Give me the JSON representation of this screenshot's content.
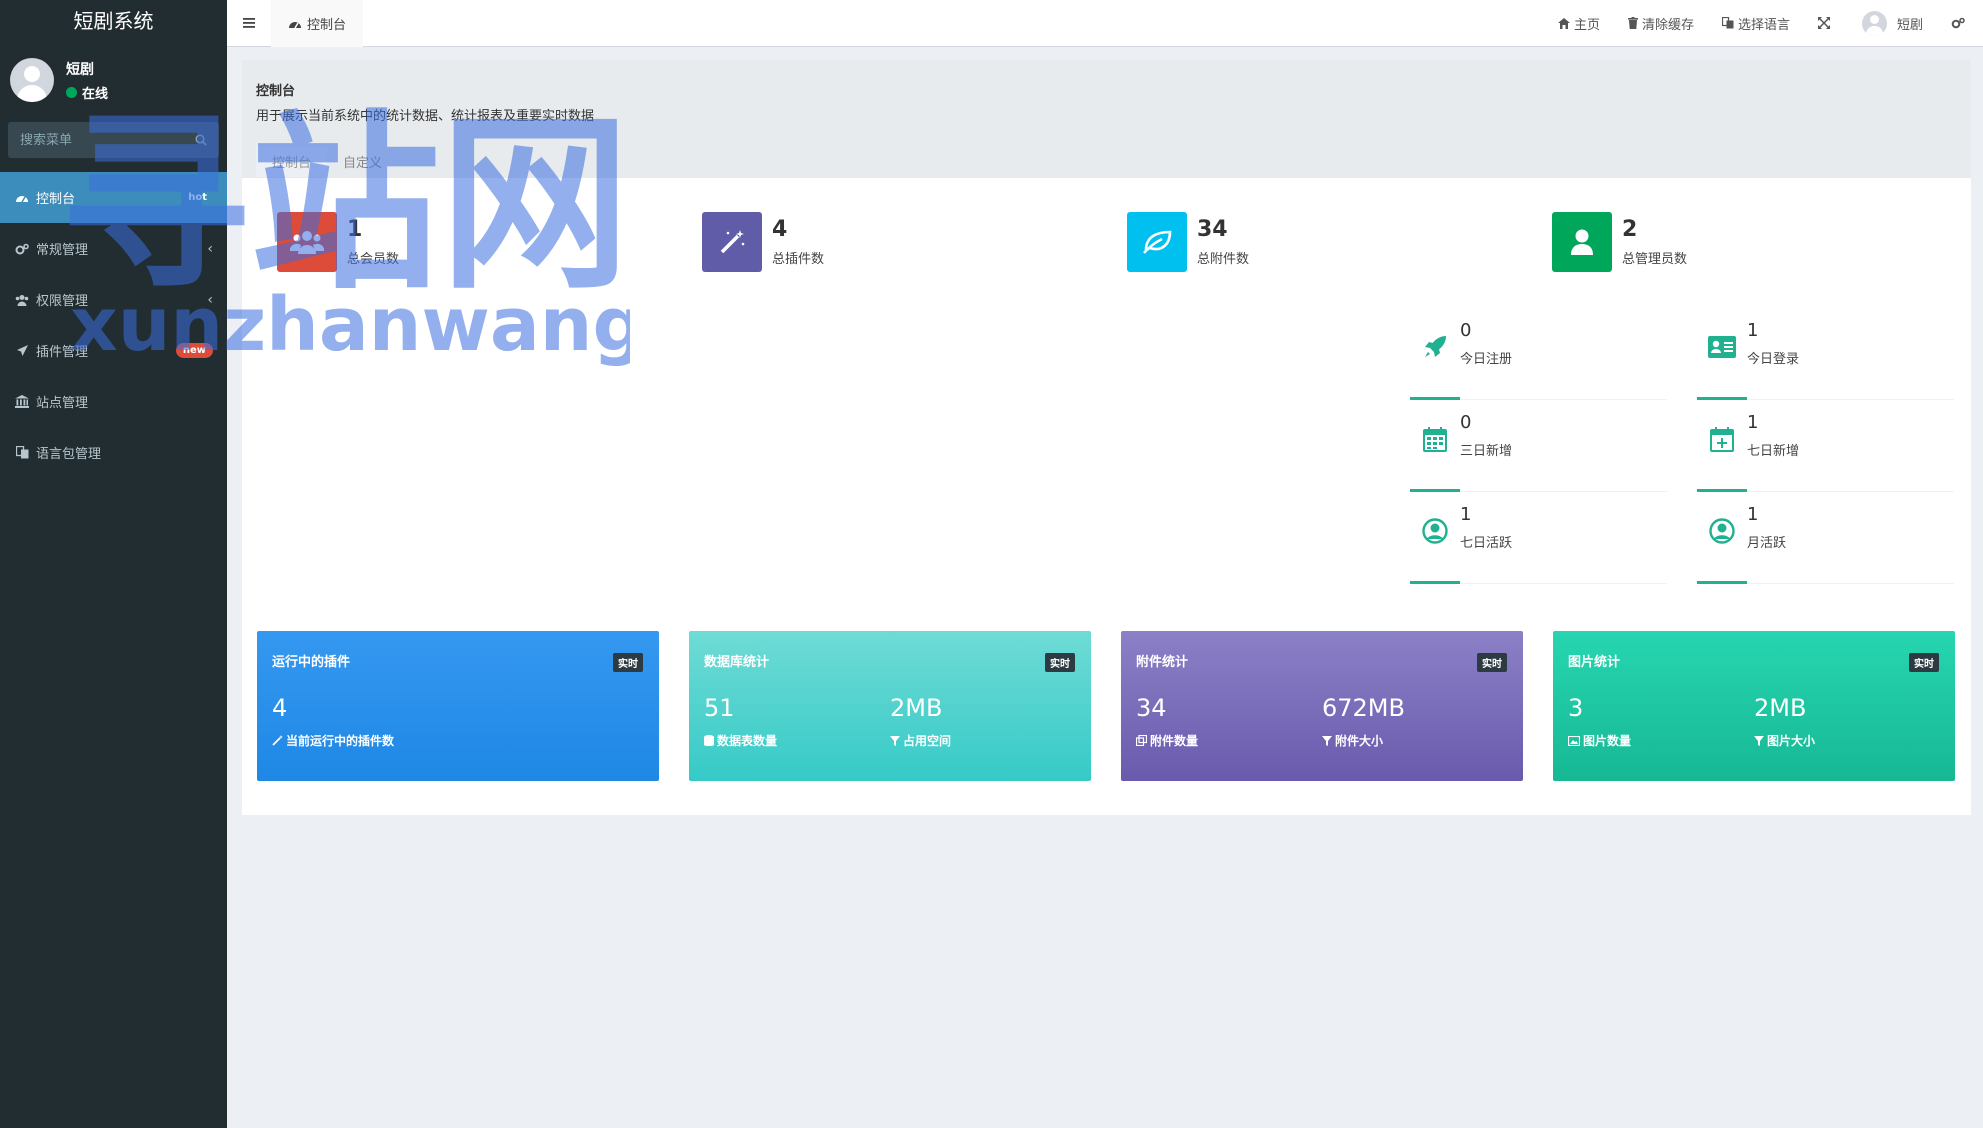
{
  "sidebar": {
    "brand": "短剧系统",
    "user": {
      "name": "短剧",
      "status": "在线"
    },
    "search_placeholder": "搜索菜单",
    "items": [
      {
        "label": "控制台",
        "badge": "hot",
        "active": true
      },
      {
        "label": "常规管理"
      },
      {
        "label": "权限管理"
      },
      {
        "label": "插件管理",
        "badge": "new"
      },
      {
        "label": "站点管理"
      },
      {
        "label": "语言包管理"
      }
    ]
  },
  "header": {
    "tab": "控制台",
    "links": {
      "home": "主页",
      "clear_cache": "清除缓存",
      "language": "选择语言",
      "user": "短剧"
    }
  },
  "content_header": {
    "title": "控制台",
    "description": "用于展示当前系统中的统计数据、统计报表及重要实时数据",
    "tabs": [
      "控制台",
      "自定义"
    ]
  },
  "stats": [
    {
      "value": "1",
      "label": "总会员数",
      "color": "#dd4b39",
      "icon": "users-icon"
    },
    {
      "value": "4",
      "label": "总插件数",
      "color": "#605ca8",
      "icon": "magic-wand-icon"
    },
    {
      "value": "34",
      "label": "总附件数",
      "color": "#00c0ef",
      "icon": "leaf-icon"
    },
    {
      "value": "2",
      "label": "总管理员数",
      "color": "#00a65a",
      "icon": "user-icon"
    }
  ],
  "mini_stats": [
    {
      "value": "0",
      "label": "今日注册",
      "icon": "rocket-icon"
    },
    {
      "value": "1",
      "label": "今日登录",
      "icon": "id-card-icon"
    },
    {
      "value": "0",
      "label": "三日新增",
      "icon": "calendar-icon"
    },
    {
      "value": "1",
      "label": "七日新增",
      "icon": "calendar-plus-icon"
    },
    {
      "value": "1",
      "label": "七日活跃",
      "icon": "user-circle-icon"
    },
    {
      "value": "1",
      "label": "月活跃",
      "icon": "user-circle-icon"
    }
  ],
  "cards": [
    {
      "title": "运行中的插件",
      "badge": "实时",
      "items": [
        {
          "value": "4",
          "label": "当前运行中的插件数"
        }
      ]
    },
    {
      "title": "数据库统计",
      "badge": "实时",
      "items": [
        {
          "value": "51",
          "label": "数据表数量"
        },
        {
          "value": "2MB",
          "label": "占用空间"
        }
      ]
    },
    {
      "title": "附件统计",
      "badge": "实时",
      "items": [
        {
          "value": "34",
          "label": "附件数量"
        },
        {
          "value": "672MB",
          "label": "附件大小"
        }
      ]
    },
    {
      "title": "图片统计",
      "badge": "实时",
      "items": [
        {
          "value": "3",
          "label": "图片数量"
        },
        {
          "value": "2MB",
          "label": "图片大小"
        }
      ]
    }
  ],
  "watermark": {
    "text_cn": "寻站网",
    "text_en": "xunzhanwang.com"
  },
  "colors": {
    "accent": "#3c8dbc",
    "sidebar_bg": "#222d32",
    "teal": "#20b190"
  }
}
